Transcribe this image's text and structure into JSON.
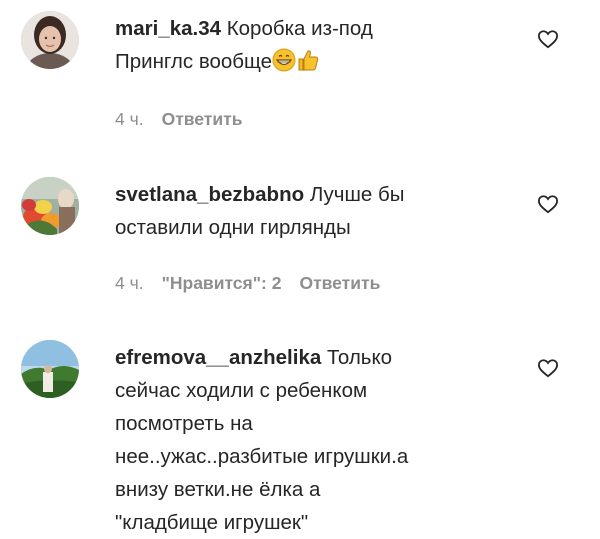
{
  "comments": [
    {
      "username": "mari_ka.34",
      "text_line1": "Коробка из-под",
      "text_line2": "Принглс вообще",
      "emojis": [
        "grinning-face-emoji",
        "thumbs-up-emoji"
      ],
      "time": "4 ч.",
      "likes": "",
      "reply": "Ответить"
    },
    {
      "username": "svetlana_bezbabno",
      "text_line1": "Лучше бы",
      "text_line2": "оставили одни гирлянды",
      "time": "4 ч.",
      "likes": "\"Нравится\": 2",
      "reply": "Ответить"
    },
    {
      "username": "efremova__anzhelika",
      "text_line1": "Только",
      "text_line2": "сейчас ходили с ребенком",
      "text_line3": "посмотреть на",
      "text_line4": "нее..ужас..разбитые игрушки.а",
      "text_line5": "внизу ветки.не ёлка а",
      "text_line6": "\"кладбище игрушек\"",
      "time": "",
      "likes": "",
      "reply": ""
    }
  ],
  "icons": {
    "like": "heart-outline-icon"
  },
  "colors": {
    "text": "#262626",
    "meta": "#8e8e8e",
    "background": "#ffffff"
  }
}
